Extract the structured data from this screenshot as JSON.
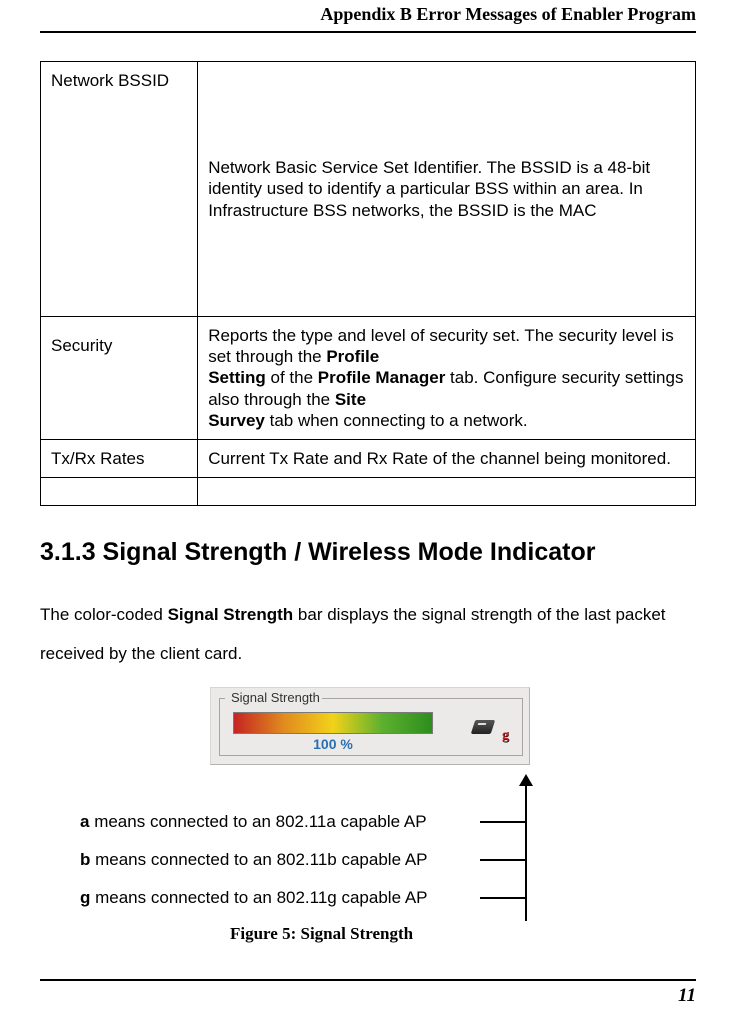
{
  "header": {
    "title": "Appendix B Error Messages of Enabler Program"
  },
  "table": {
    "rows": [
      {
        "term": "Network BSSID",
        "desc": "Network Basic Service Set Identifier. The BSSID is a 48-bit identity used to identify a particular BSS within an area. In Infrastructure BSS networks, the BSSID is the MAC"
      },
      {
        "term": "Security",
        "desc1": "Reports the type and level of security set. The security level is set through the ",
        "bold1": "Profile",
        "bold2": "Setting",
        "desc2": " of the ",
        "bold3": "Profile Manager",
        "desc3": " tab. Configure security settings also through the ",
        "bold4": "Site",
        "bold5": "Survey",
        "desc4": " tab when connecting to a network."
      },
      {
        "term": "Tx/Rx Rates",
        "desc": "Current Tx Rate and Rx Rate of the channel being monitored."
      }
    ]
  },
  "section": {
    "heading": "3.1.3 Signal Strength / Wireless Mode Indicator",
    "para1a": "The color-coded ",
    "para1bold": "Signal Strength",
    "para1b": " bar displays the signal strength of the last packet received by the client card."
  },
  "figure": {
    "fieldset_label": "Signal Strength",
    "percent": "100 %",
    "mode_badge": "g",
    "legend_a_bold": "a",
    "legend_a_text": " means connected to an 802.11a capable AP",
    "legend_b_bold": "b",
    "legend_b_text": " means connected to an 802.11b capable AP",
    "legend_g_bold": "g",
    "legend_g_text": " means connected to an 802.11g capable AP",
    "caption": "Figure 5: Signal Strength"
  },
  "footer": {
    "page": "11"
  }
}
